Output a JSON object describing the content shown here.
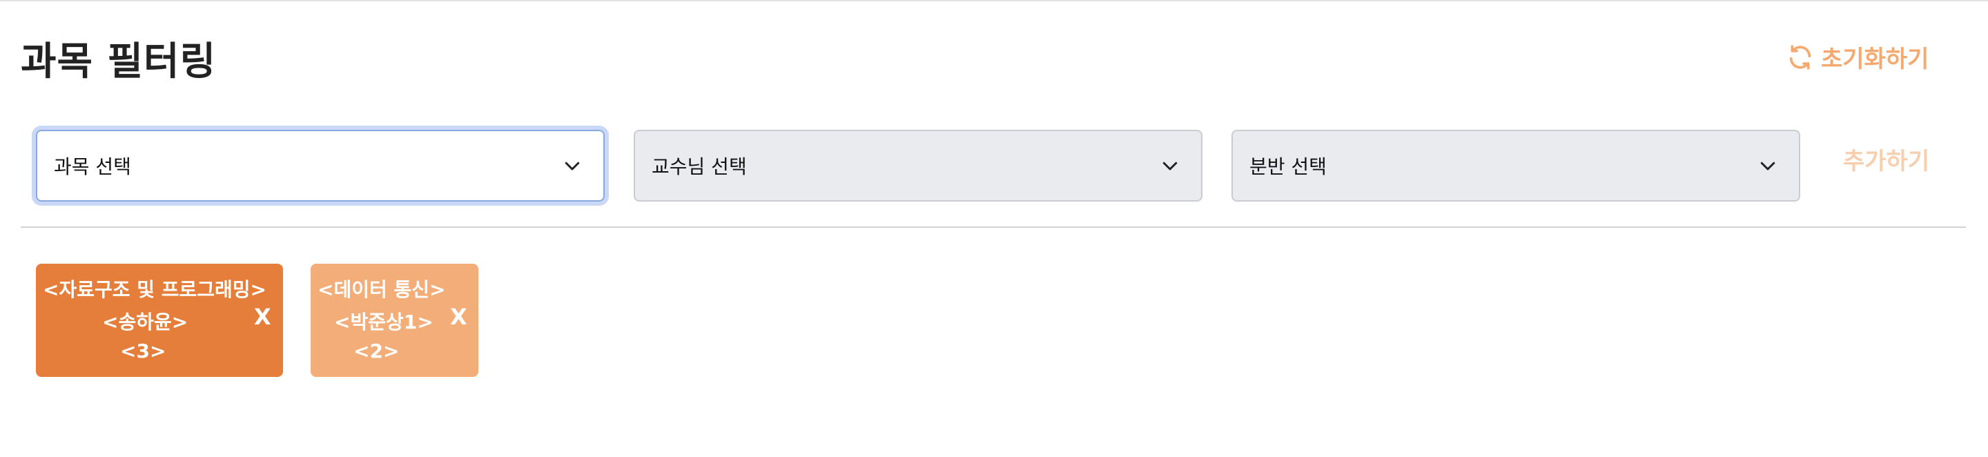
{
  "header": {
    "title": "과목 필터링",
    "reset_label": "초기화하기"
  },
  "filters": {
    "subject_placeholder": "과목 선택",
    "professor_placeholder": "교수님 선택",
    "section_placeholder": "분반 선택",
    "add_label": "추가하기"
  },
  "selected": [
    {
      "subject": "<자료구조 및 프로그래밍>",
      "professor": "<송하윤>",
      "section": "<3>",
      "remove_label": "X",
      "color": "#e57e3a"
    },
    {
      "subject": "<데이터 통신>",
      "professor": "<박준상1>",
      "section": "<2>",
      "remove_label": "X",
      "color": "#f2ad79"
    }
  ],
  "colors": {
    "accent": "#f5a96e",
    "focus_ring": "#c9d8f7"
  },
  "icons": [
    "refresh-icon",
    "chevron-down-icon"
  ]
}
